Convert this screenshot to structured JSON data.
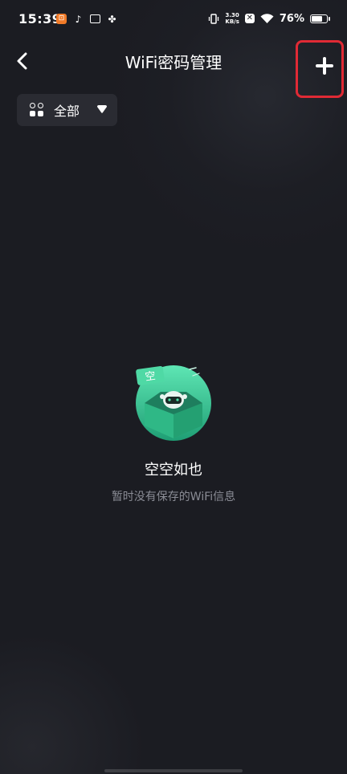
{
  "status_bar": {
    "time": "15:39",
    "net_speed_value": "3.30",
    "net_speed_unit": "KB/s",
    "battery_percent": "76%",
    "battery_level": 0.76,
    "app_icons": [
      "orange-app-icon",
      "tiktok-icon",
      "chat-box-icon",
      "fan-icon"
    ]
  },
  "header": {
    "title": "WiFi密码管理",
    "back_icon": "chevron-left-icon",
    "add_icon": "plus-icon",
    "highlight_color": "#e02a35"
  },
  "filter": {
    "label": "全部",
    "icon": "grid-icon",
    "dropdown_icon": "caret-down-icon"
  },
  "empty_state": {
    "badge_text": "空",
    "title": "空空如也",
    "subtitle": "暂时没有保存的WiFi信息",
    "accent_color": "#3ed6a0"
  }
}
